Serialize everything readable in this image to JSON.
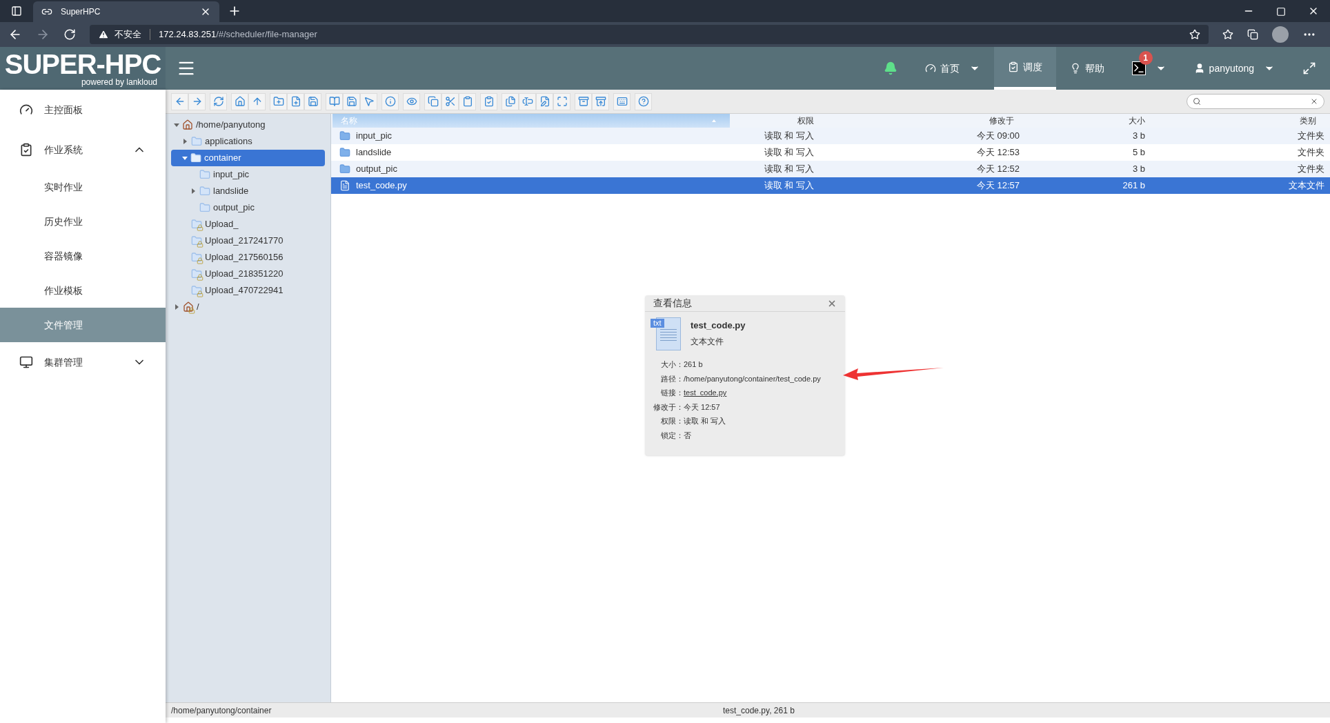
{
  "browser": {
    "tab_title": "SuperHPC",
    "security": "不安全",
    "url_host": "172.24.83.251",
    "url_path": "/#/scheduler/file-manager"
  },
  "app": {
    "logo": "SUPER-HPC",
    "logo_sub": "powered by lankloud",
    "nav": [
      {
        "kind": "bell",
        "selected": false
      },
      {
        "kind": "home",
        "label": "首页",
        "selected": false,
        "dropdown": true
      },
      {
        "kind": "schedule",
        "label": "调度",
        "selected": true
      },
      {
        "kind": "help",
        "label": "帮助",
        "selected": false
      },
      {
        "kind": "terminal",
        "badge": "1",
        "selected": false,
        "dropdown": true
      },
      {
        "kind": "user",
        "label": "panyutong",
        "selected": false,
        "dropdown": true
      },
      {
        "kind": "fullscreen",
        "selected": false
      }
    ]
  },
  "sidebar": [
    {
      "kind": "dashboard",
      "label": "主控面板"
    },
    {
      "kind": "jobs",
      "label": "作业系统",
      "expanded": true,
      "children": [
        {
          "label": "实时作业",
          "selected": false
        },
        {
          "label": "历史作业",
          "selected": false
        },
        {
          "label": "容器镜像",
          "selected": false
        },
        {
          "label": "作业模板",
          "selected": false
        },
        {
          "label": "文件管理",
          "selected": true
        }
      ]
    },
    {
      "kind": "cluster",
      "label": "集群管理",
      "expanded": false
    }
  ],
  "tree": [
    {
      "label": "/home/panyutong",
      "kind": "home",
      "expanded": true,
      "selected": false,
      "children": [
        {
          "label": "applications",
          "kind": "folder",
          "expanded": false,
          "selected": false
        },
        {
          "label": "container",
          "kind": "folder",
          "expanded": true,
          "selected": true,
          "children": [
            {
              "label": "input_pic",
              "kind": "folder",
              "selected": false
            },
            {
              "label": "landslide",
              "kind": "folder",
              "expanded": false,
              "selected": false
            },
            {
              "label": "output_pic",
              "kind": "folder",
              "selected": false
            }
          ]
        },
        {
          "label": "Upload_",
          "kind": "locked",
          "selected": false
        },
        {
          "label": "Upload_217241770",
          "kind": "locked",
          "selected": false
        },
        {
          "label": "Upload_217560156",
          "kind": "locked",
          "selected": false
        },
        {
          "label": "Upload_218351220",
          "kind": "locked",
          "selected": false
        },
        {
          "label": "Upload_470722941",
          "kind": "locked",
          "selected": false
        }
      ]
    },
    {
      "label": "/",
      "kind": "root",
      "expanded": false,
      "selected": false
    }
  ],
  "table": {
    "columns": [
      "名称",
      "权限",
      "修改于",
      "大小",
      "类别"
    ],
    "rows": [
      {
        "kind": "folder",
        "name": "input_pic",
        "permissions": "读取 和 写入",
        "modified": "今天 09:00",
        "size": "3 b",
        "type": "文件夹",
        "selected": false
      },
      {
        "kind": "folder",
        "name": "landslide",
        "permissions": "读取 和 写入",
        "modified": "今天 12:53",
        "size": "5 b",
        "type": "文件夹",
        "selected": false
      },
      {
        "kind": "folder",
        "name": "output_pic",
        "permissions": "读取 和 写入",
        "modified": "今天 12:52",
        "size": "3 b",
        "type": "文件夹",
        "selected": false
      },
      {
        "kind": "file",
        "name": "test_code.py",
        "permissions": "读取 和 写入",
        "modified": "今天 12:57",
        "size": "261 b",
        "type": "文本文件",
        "selected": true
      }
    ]
  },
  "info_dialog": {
    "title": "查看信息",
    "icon_label": "txt",
    "file_name": "test_code.py",
    "file_type": "文本文件",
    "fields": [
      {
        "label": "大小：",
        "value": "261 b",
        "kind": "text"
      },
      {
        "label": "路径：",
        "value": "/home/panyutong/container/test_code.py",
        "kind": "text"
      },
      {
        "label": "链接：",
        "value": "test_code.py",
        "kind": "link"
      },
      {
        "label": "修改于：",
        "value": "今天 12:57",
        "kind": "text"
      },
      {
        "label": "权限：",
        "value": "读取 和 写入",
        "kind": "text"
      },
      {
        "label": "锁定：",
        "value": "否",
        "kind": "text"
      }
    ]
  },
  "status_bar": {
    "path": "/home/panyutong/container",
    "selection": "test_code.py, 261 b"
  }
}
